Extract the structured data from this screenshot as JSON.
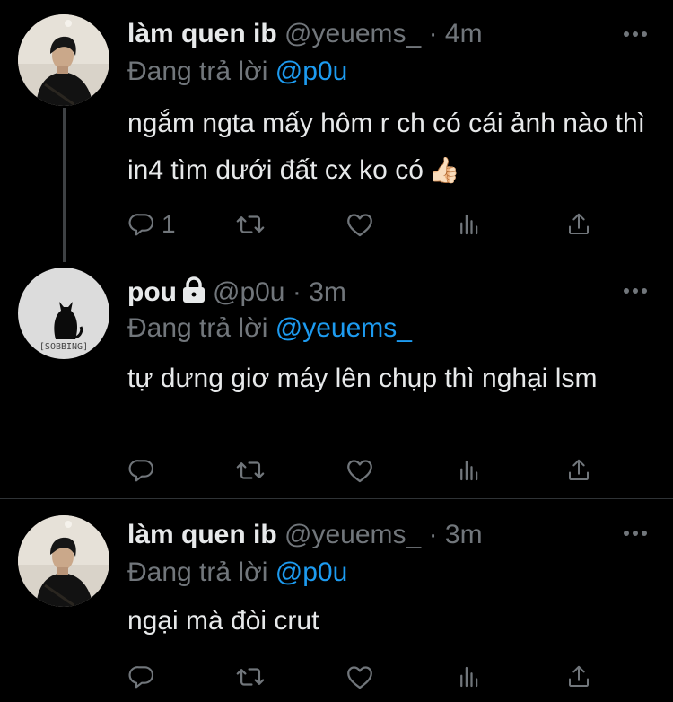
{
  "tweets": [
    {
      "display_name": "làm quen ib",
      "handle": "@yeuems_",
      "dot": "·",
      "time": "4m",
      "reply_prefix": "Đang trả lời",
      "reply_to": "@p0u",
      "text": "ngắm ngta mấy hôm r ch có cái ảnh nào thì in4 tìm dưới đất cx ko có",
      "emoji": "👍🏻",
      "reply_count": "1",
      "protected": false
    },
    {
      "display_name": "pou",
      "handle": "@p0u",
      "dot": "·",
      "time": "3m",
      "reply_prefix": "Đang trả lời",
      "reply_to": "@yeuems_",
      "text": "tự dưng giơ máy lên chụp thì nghại lsm",
      "avatar_caption": "[SOBBING]",
      "reply_count": "",
      "protected": true
    },
    {
      "display_name": "làm quen ib",
      "handle": "@yeuems_",
      "dot": "·",
      "time": "3m",
      "reply_prefix": "Đang trả lời",
      "reply_to": "@p0u",
      "text": "ngại mà đòi crut",
      "reply_count": "",
      "protected": false
    }
  ],
  "icons": {
    "reply": "reply-icon",
    "retweet": "retweet-icon",
    "like": "heart-icon",
    "analytics": "analytics-icon",
    "share": "share-icon",
    "more": "more-icon",
    "lock": "lock-icon"
  },
  "colors": {
    "background": "#000000",
    "primary_text": "#e7e9ea",
    "secondary_text": "#71767b",
    "mention": "#1d9bf0",
    "divider": "#2f3336"
  }
}
